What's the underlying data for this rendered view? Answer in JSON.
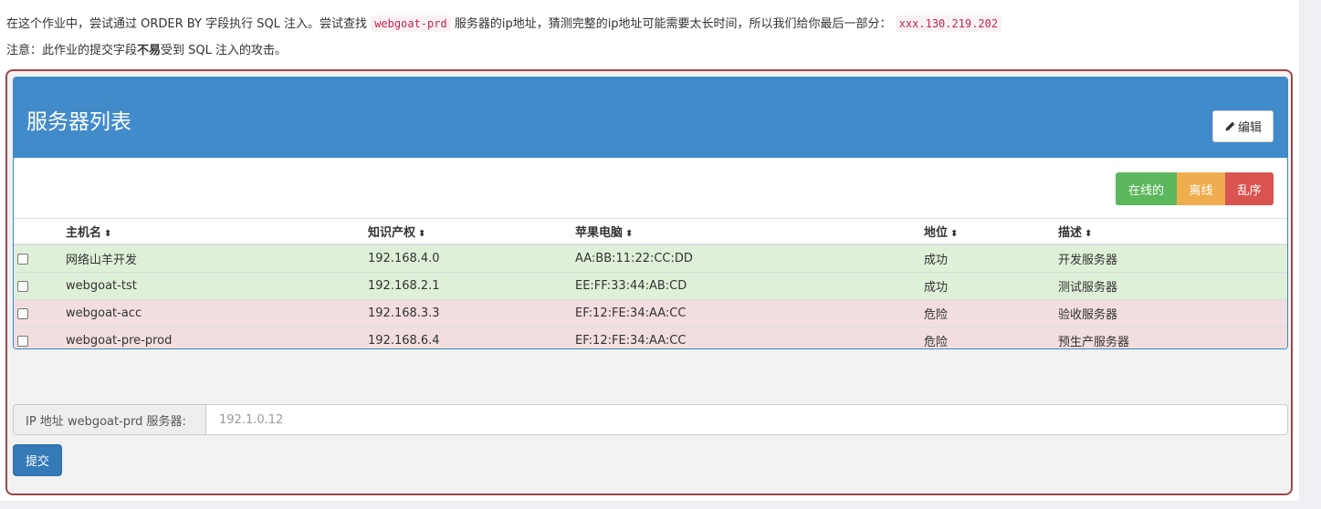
{
  "intro": {
    "text_before": "在这个作业中，尝试通过 ORDER BY 字段执行 SQL 注入。尝试查找",
    "target_host": "webgoat-prd",
    "text_middle": "服务器的ip地址，猜测完整的ip地址可能需要太长时间，所以我们给你最后一部分：",
    "ip_hint": "xxx.130.219.202"
  },
  "note": {
    "prefix": "注意：此作业的提交字段",
    "bold": "不易",
    "suffix": "受到 SQL 注入的攻击。"
  },
  "panel": {
    "title": "服务器列表",
    "edit_label": "编辑",
    "edit_icon": "pencil-icon"
  },
  "status_buttons": {
    "online": "在线的",
    "offline": "离线",
    "chaos": "乱序"
  },
  "table": {
    "headers": [
      "主机名",
      "知识产权",
      "苹果电脑",
      "地位",
      "描述"
    ],
    "rows": [
      {
        "hostname": "网络山羊开发",
        "ip": "192.168.4.0",
        "mac": "AA:BB:11:22:CC:DD",
        "status": "成功",
        "description": "开发服务器",
        "state": "success"
      },
      {
        "hostname": "webgoat-tst",
        "ip": "192.168.2.1",
        "mac": "EE:FF:33:44:AB:CD",
        "status": "成功",
        "description": "测试服务器",
        "state": "success"
      },
      {
        "hostname": "webgoat-acc",
        "ip": "192.168.3.3",
        "mac": "EF:12:FE:34:AA:CC",
        "status": "危险",
        "description": "验收服务器",
        "state": "danger"
      },
      {
        "hostname": "webgoat-pre-prod",
        "ip": "192.168.6.4",
        "mac": "EF:12:FE:34:AA:CC",
        "status": "危险",
        "description": "预生产服务器",
        "state": "danger"
      }
    ]
  },
  "form": {
    "label": "IP 地址 webgoat-prd 服务器:",
    "placeholder": "192.1.0.12",
    "submit_label": "提交"
  },
  "colors": {
    "panel_heading": "#428bca",
    "online": "#5cb85c",
    "offline": "#f0ad4e",
    "chaos": "#d9534f",
    "row_success": "#dff0d8",
    "row_danger": "#f2dede",
    "assignment_border": "#a0454a"
  }
}
